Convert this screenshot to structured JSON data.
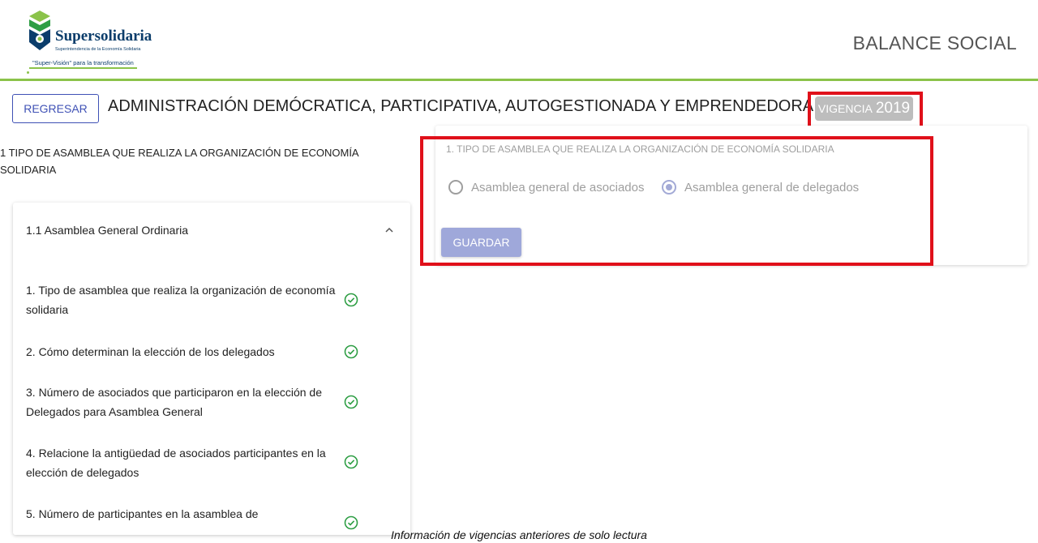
{
  "header": {
    "logo_title": "Supersolidaria",
    "logo_subtitle": "Superintendencia de la Economía Solidaria",
    "logo_tagline": "\"Super-Visión\" para la transformación",
    "app_title": "BALANCE SOCIAL"
  },
  "toolbar": {
    "back_label": "REGRESAR",
    "page_title": "ADMINISTRACIÓN DEMÓCRATICA, PARTICIPATIVA, AUTOGESTIONADA Y EMPRENDEDORA",
    "vigencia_label": "VIGENCIA",
    "vigencia_year": "2019"
  },
  "sidebar": {
    "heading": "1 TIPO DE ASAMBLEA QUE REALIZA LA ORGANIZACIÓN DE ECONOMÍA SOLIDARIA",
    "section_title": "1.1 Asamblea General Ordinaria",
    "items": [
      {
        "label": "1. Tipo de asamblea que realiza la organización de economía solidaria",
        "status": "check-circle-icon"
      },
      {
        "label": "2. Cómo determinan la elección de los delegados",
        "status": "check-circle-icon"
      },
      {
        "label": "3. Número de asociados que participaron en la elección de Delegados para Asamblea General",
        "status": "check-circle-icon"
      },
      {
        "label": "4. Relacione la antigüedad de asociados participantes en la elección de delegados",
        "status": "check-circle-icon"
      },
      {
        "label": "5. Número de participantes en la asamblea de",
        "status": "check-circle-icon"
      }
    ]
  },
  "form": {
    "question": "1. TIPO DE ASAMBLEA QUE REALIZA LA ORGANIZACIÓN DE ECONOMÍA SOLIDARIA",
    "options": [
      {
        "label": "Asamblea general de asociados",
        "selected": false
      },
      {
        "label": "Asamblea general de delegados",
        "selected": true
      }
    ],
    "save_label": "GUARDAR"
  },
  "caption": "Información de vigencias anteriores de solo lectura",
  "colors": {
    "accent": "#3f51b5",
    "brand_green": "#8bc34a",
    "highlight_red": "#e0101a",
    "success_green": "#2e9e44",
    "disabled_button": "#9fa8da"
  }
}
